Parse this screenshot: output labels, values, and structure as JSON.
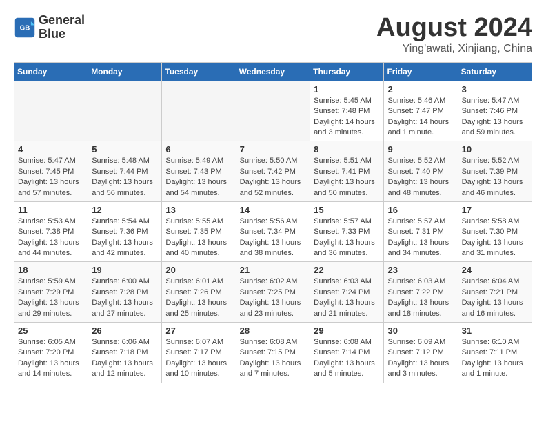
{
  "header": {
    "logo_line1": "General",
    "logo_line2": "Blue",
    "month_year": "August 2024",
    "location": "Ying'awati, Xinjiang, China"
  },
  "weekdays": [
    "Sunday",
    "Monday",
    "Tuesday",
    "Wednesday",
    "Thursday",
    "Friday",
    "Saturday"
  ],
  "weeks": [
    [
      {
        "day": "",
        "info": ""
      },
      {
        "day": "",
        "info": ""
      },
      {
        "day": "",
        "info": ""
      },
      {
        "day": "",
        "info": ""
      },
      {
        "day": "1",
        "info": "Sunrise: 5:45 AM\nSunset: 7:48 PM\nDaylight: 14 hours\nand 3 minutes."
      },
      {
        "day": "2",
        "info": "Sunrise: 5:46 AM\nSunset: 7:47 PM\nDaylight: 14 hours\nand 1 minute."
      },
      {
        "day": "3",
        "info": "Sunrise: 5:47 AM\nSunset: 7:46 PM\nDaylight: 13 hours\nand 59 minutes."
      }
    ],
    [
      {
        "day": "4",
        "info": "Sunrise: 5:47 AM\nSunset: 7:45 PM\nDaylight: 13 hours\nand 57 minutes."
      },
      {
        "day": "5",
        "info": "Sunrise: 5:48 AM\nSunset: 7:44 PM\nDaylight: 13 hours\nand 56 minutes."
      },
      {
        "day": "6",
        "info": "Sunrise: 5:49 AM\nSunset: 7:43 PM\nDaylight: 13 hours\nand 54 minutes."
      },
      {
        "day": "7",
        "info": "Sunrise: 5:50 AM\nSunset: 7:42 PM\nDaylight: 13 hours\nand 52 minutes."
      },
      {
        "day": "8",
        "info": "Sunrise: 5:51 AM\nSunset: 7:41 PM\nDaylight: 13 hours\nand 50 minutes."
      },
      {
        "day": "9",
        "info": "Sunrise: 5:52 AM\nSunset: 7:40 PM\nDaylight: 13 hours\nand 48 minutes."
      },
      {
        "day": "10",
        "info": "Sunrise: 5:52 AM\nSunset: 7:39 PM\nDaylight: 13 hours\nand 46 minutes."
      }
    ],
    [
      {
        "day": "11",
        "info": "Sunrise: 5:53 AM\nSunset: 7:38 PM\nDaylight: 13 hours\nand 44 minutes."
      },
      {
        "day": "12",
        "info": "Sunrise: 5:54 AM\nSunset: 7:36 PM\nDaylight: 13 hours\nand 42 minutes."
      },
      {
        "day": "13",
        "info": "Sunrise: 5:55 AM\nSunset: 7:35 PM\nDaylight: 13 hours\nand 40 minutes."
      },
      {
        "day": "14",
        "info": "Sunrise: 5:56 AM\nSunset: 7:34 PM\nDaylight: 13 hours\nand 38 minutes."
      },
      {
        "day": "15",
        "info": "Sunrise: 5:57 AM\nSunset: 7:33 PM\nDaylight: 13 hours\nand 36 minutes."
      },
      {
        "day": "16",
        "info": "Sunrise: 5:57 AM\nSunset: 7:31 PM\nDaylight: 13 hours\nand 34 minutes."
      },
      {
        "day": "17",
        "info": "Sunrise: 5:58 AM\nSunset: 7:30 PM\nDaylight: 13 hours\nand 31 minutes."
      }
    ],
    [
      {
        "day": "18",
        "info": "Sunrise: 5:59 AM\nSunset: 7:29 PM\nDaylight: 13 hours\nand 29 minutes."
      },
      {
        "day": "19",
        "info": "Sunrise: 6:00 AM\nSunset: 7:28 PM\nDaylight: 13 hours\nand 27 minutes."
      },
      {
        "day": "20",
        "info": "Sunrise: 6:01 AM\nSunset: 7:26 PM\nDaylight: 13 hours\nand 25 minutes."
      },
      {
        "day": "21",
        "info": "Sunrise: 6:02 AM\nSunset: 7:25 PM\nDaylight: 13 hours\nand 23 minutes."
      },
      {
        "day": "22",
        "info": "Sunrise: 6:03 AM\nSunset: 7:24 PM\nDaylight: 13 hours\nand 21 minutes."
      },
      {
        "day": "23",
        "info": "Sunrise: 6:03 AM\nSunset: 7:22 PM\nDaylight: 13 hours\nand 18 minutes."
      },
      {
        "day": "24",
        "info": "Sunrise: 6:04 AM\nSunset: 7:21 PM\nDaylight: 13 hours\nand 16 minutes."
      }
    ],
    [
      {
        "day": "25",
        "info": "Sunrise: 6:05 AM\nSunset: 7:20 PM\nDaylight: 13 hours\nand 14 minutes."
      },
      {
        "day": "26",
        "info": "Sunrise: 6:06 AM\nSunset: 7:18 PM\nDaylight: 13 hours\nand 12 minutes."
      },
      {
        "day": "27",
        "info": "Sunrise: 6:07 AM\nSunset: 7:17 PM\nDaylight: 13 hours\nand 10 minutes."
      },
      {
        "day": "28",
        "info": "Sunrise: 6:08 AM\nSunset: 7:15 PM\nDaylight: 13 hours\nand 7 minutes."
      },
      {
        "day": "29",
        "info": "Sunrise: 6:08 AM\nSunset: 7:14 PM\nDaylight: 13 hours\nand 5 minutes."
      },
      {
        "day": "30",
        "info": "Sunrise: 6:09 AM\nSunset: 7:12 PM\nDaylight: 13 hours\nand 3 minutes."
      },
      {
        "day": "31",
        "info": "Sunrise: 6:10 AM\nSunset: 7:11 PM\nDaylight: 13 hours\nand 1 minute."
      }
    ]
  ]
}
